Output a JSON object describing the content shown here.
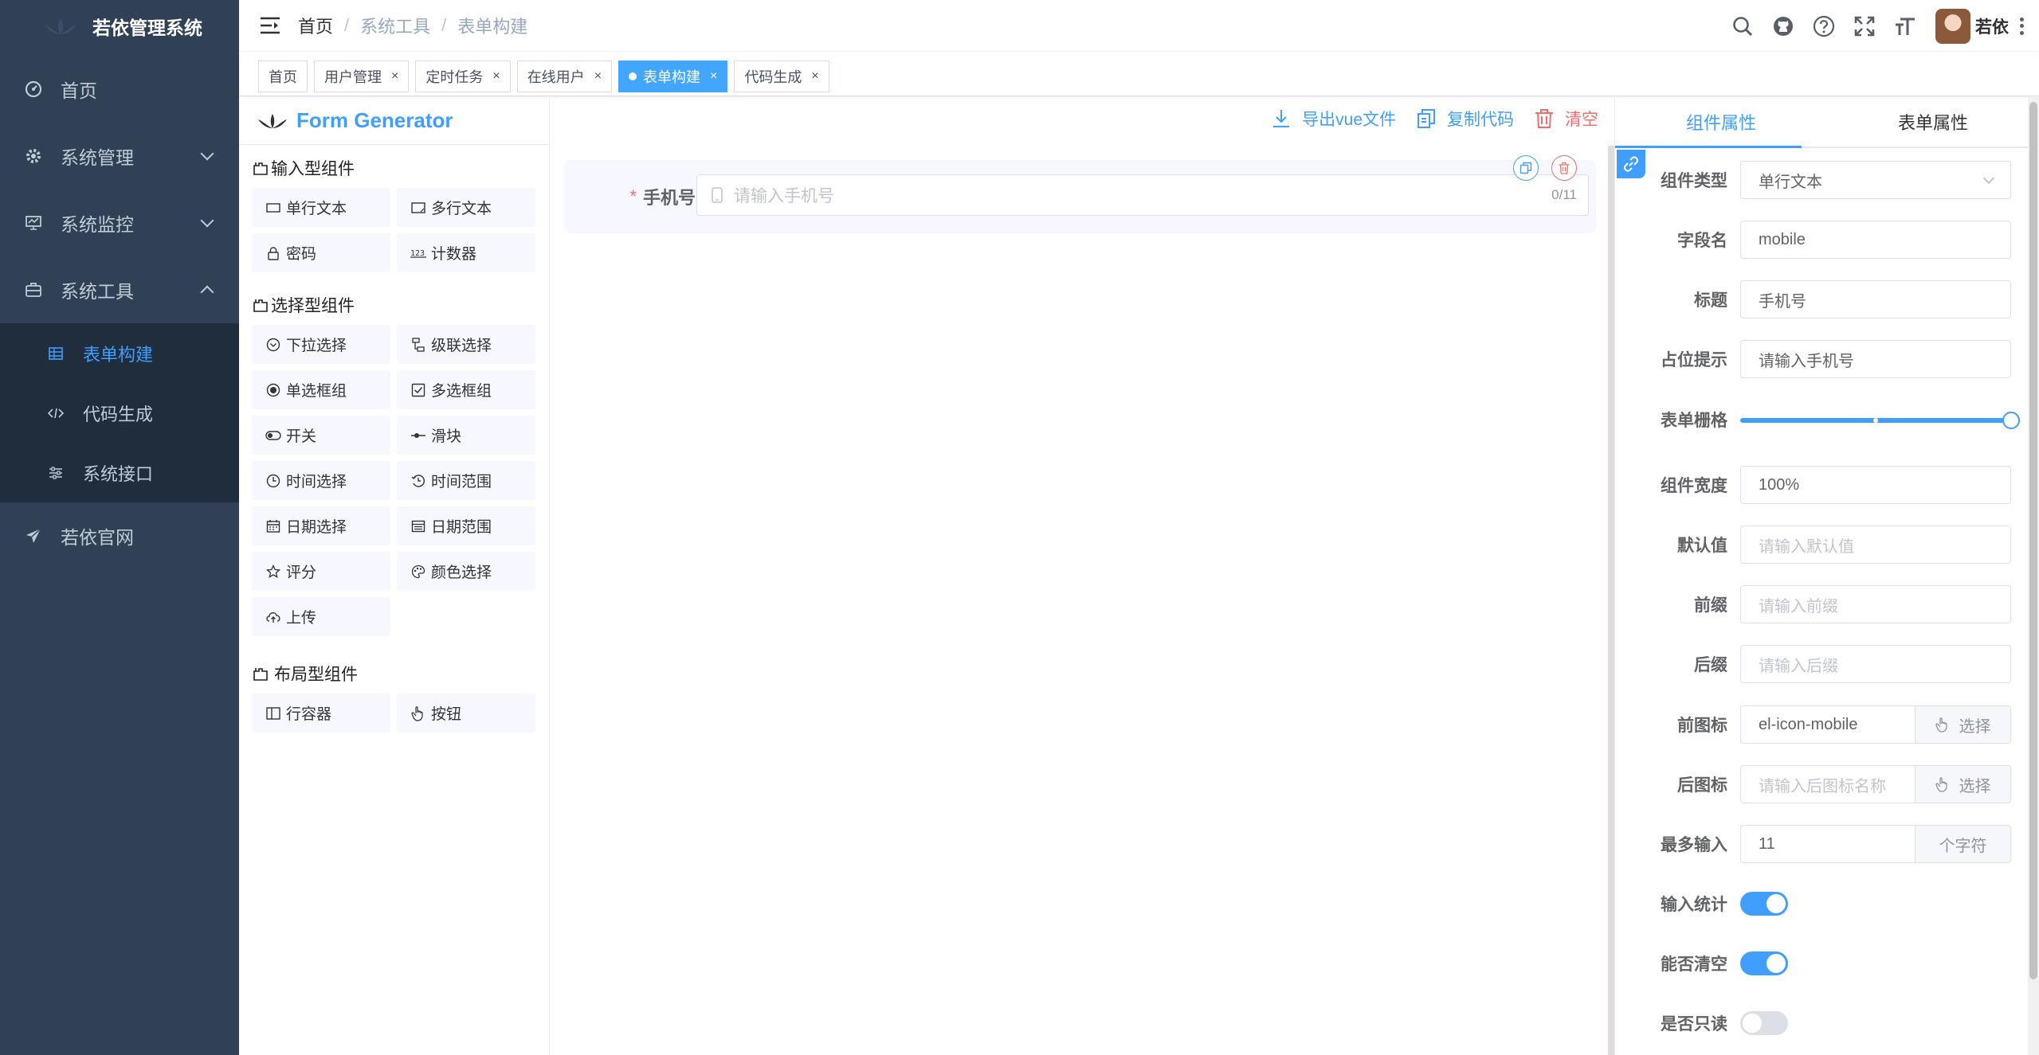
{
  "app": {
    "title": "若依管理系统"
  },
  "sidebar": {
    "items": [
      {
        "label": "首页",
        "icon": "dashboard-icon"
      },
      {
        "label": "系统管理",
        "icon": "gear-icon"
      },
      {
        "label": "系统监控",
        "icon": "monitor-icon"
      },
      {
        "label": "系统工具",
        "icon": "toolbox-icon"
      },
      {
        "label": "若依官网",
        "icon": "send-icon"
      }
    ],
    "sub_items": [
      {
        "label": "表单构建",
        "icon": "table-icon",
        "active": true
      },
      {
        "label": "代码生成",
        "icon": "code-icon"
      },
      {
        "label": "系统接口",
        "icon": "sliders-icon"
      }
    ]
  },
  "navbar": {
    "breadcrumb": [
      "首页",
      "系统工具",
      "表单构建"
    ],
    "breadcrumb_sep": "/",
    "user_name": "若依"
  },
  "tags": [
    {
      "label": "首页",
      "closable": false
    },
    {
      "label": "用户管理",
      "closable": true
    },
    {
      "label": "定时任务",
      "closable": true
    },
    {
      "label": "在线用户",
      "closable": true
    },
    {
      "label": "表单构建",
      "closable": true,
      "active": true
    },
    {
      "label": "代码生成",
      "closable": true
    }
  ],
  "tag_close": "×",
  "generator": {
    "brand": "Form Generator",
    "groups": [
      {
        "title": "输入型组件",
        "items": [
          {
            "label": "单行文本",
            "icon": "input-icon"
          },
          {
            "label": "多行文本",
            "icon": "textarea-icon"
          },
          {
            "label": "密码",
            "icon": "lock-icon"
          },
          {
            "label": "计数器",
            "icon": "number-icon"
          }
        ]
      },
      {
        "title": "选择型组件",
        "items": [
          {
            "label": "下拉选择",
            "icon": "select-icon"
          },
          {
            "label": "级联选择",
            "icon": "cascader-icon"
          },
          {
            "label": "单选框组",
            "icon": "radio-icon"
          },
          {
            "label": "多选框组",
            "icon": "checkbox-icon"
          },
          {
            "label": "开关",
            "icon": "switch-icon"
          },
          {
            "label": "滑块",
            "icon": "slider-icon"
          },
          {
            "label": "时间选择",
            "icon": "clock-icon"
          },
          {
            "label": "时间范围",
            "icon": "time-range-icon"
          },
          {
            "label": "日期选择",
            "icon": "calendar-icon"
          },
          {
            "label": "日期范围",
            "icon": "date-range-icon"
          },
          {
            "label": "评分",
            "icon": "star-icon"
          },
          {
            "label": "颜色选择",
            "icon": "palette-icon"
          },
          {
            "label": "上传",
            "icon": "upload-icon"
          }
        ]
      },
      {
        "title": "布局型组件",
        "items": [
          {
            "label": "行容器",
            "icon": "row-icon"
          },
          {
            "label": "按钮",
            "icon": "hand-icon"
          }
        ]
      }
    ],
    "actions": {
      "export": "导出vue文件",
      "copy": "复制代码",
      "clear": "清空"
    },
    "canvas_field": {
      "label": "手机号",
      "required_mark": "*",
      "placeholder": "请输入手机号",
      "count": "0/11"
    }
  },
  "properties": {
    "tabs": [
      "组件属性",
      "表单属性"
    ],
    "rows": [
      {
        "label": "组件类型",
        "kind": "select",
        "value": "单行文本"
      },
      {
        "label": "字段名",
        "kind": "input",
        "value": "mobile"
      },
      {
        "label": "标题",
        "kind": "input",
        "value": "手机号"
      },
      {
        "label": "占位提示",
        "kind": "input",
        "value": "请输入手机号"
      },
      {
        "label": "表单栅格",
        "kind": "slider",
        "value": 24,
        "min": 0,
        "max": 24
      },
      {
        "label": "组件宽度",
        "kind": "input",
        "value": "100%"
      },
      {
        "label": "默认值",
        "kind": "input",
        "placeholder": "请输入默认值"
      },
      {
        "label": "前缀",
        "kind": "input",
        "placeholder": "请输入前缀"
      },
      {
        "label": "后缀",
        "kind": "input",
        "placeholder": "请输入后缀"
      },
      {
        "label": "前图标",
        "kind": "input-append",
        "value": "el-icon-mobile",
        "append": "选择",
        "append_icon": "hand-icon"
      },
      {
        "label": "后图标",
        "kind": "input-append",
        "placeholder": "请输入后图标名称",
        "append": "选择",
        "append_icon": "hand-icon"
      },
      {
        "label": "最多输入",
        "kind": "input-append",
        "value": "11",
        "append": "个字符"
      },
      {
        "label": "输入统计",
        "kind": "switch",
        "on": true
      },
      {
        "label": "能否清空",
        "kind": "switch",
        "on": true
      },
      {
        "label": "是否只读",
        "kind": "switch",
        "on": false
      }
    ]
  },
  "colors": {
    "sidebar_bg": "#304156",
    "submenu_bg": "#1f2d3d",
    "primary": "#409eff",
    "danger": "#f56c6c"
  }
}
